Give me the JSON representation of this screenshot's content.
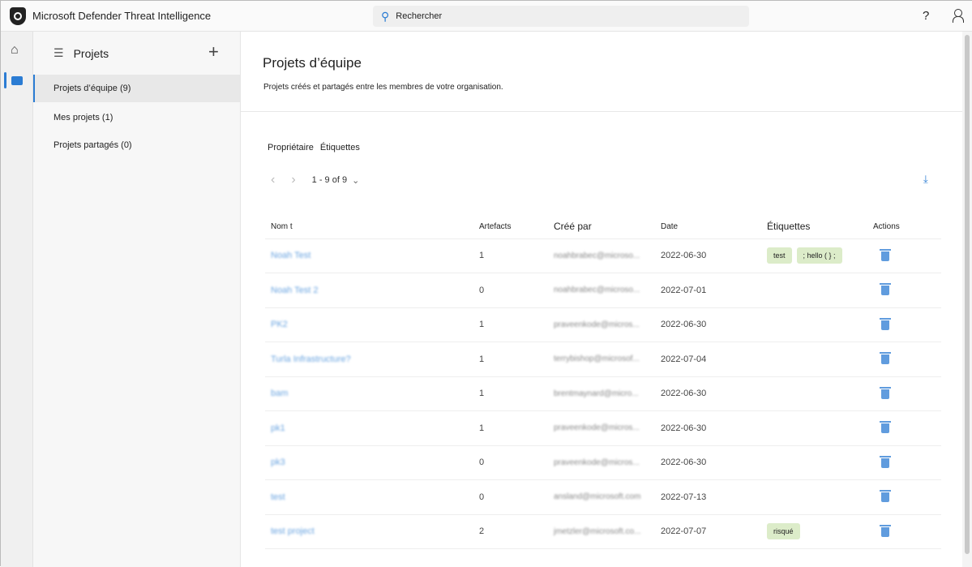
{
  "app": {
    "title": "Microsoft Defender Threat Intelligence",
    "search_placeholder": "Rechercher",
    "help": "?"
  },
  "sidebar": {
    "title": "Projets",
    "items": [
      {
        "label": "Projets d’équipe (9)"
      },
      {
        "label": "Mes projets (1)"
      },
      {
        "label": "Projets partagés (0)"
      }
    ]
  },
  "main": {
    "title": "Projets d’équipe",
    "subtitle": "Projets créés et partagés entre les membres de votre organisation.",
    "filters": [
      "Propriétaire",
      "Étiquettes"
    ],
    "pager": "1 - 9 of 9",
    "columns": [
      "Nom t",
      "Artefacts",
      "Créé par",
      "Date",
      "Étiquettes",
      "Actions"
    ],
    "rows": [
      {
        "name": "Noah Test",
        "artifacts": "1",
        "creator": "noahbrabec@microso...",
        "date": "2022-06-30",
        "tags": [
          "test",
          "; hello ( } ;"
        ]
      },
      {
        "name": "Noah Test 2",
        "artifacts": "0",
        "creator": "noahbrabec@microso...",
        "date": "2022-07-01",
        "tags": []
      },
      {
        "name": "PK2",
        "artifacts": "1",
        "creator": "praveenkode@micros...",
        "date": "2022-06-30",
        "tags": []
      },
      {
        "name": "Turla Infrastructure?",
        "artifacts": "1",
        "creator": "terrybishop@microsof...",
        "date": "2022-07-04",
        "tags": []
      },
      {
        "name": "bam",
        "artifacts": "1",
        "creator": "brentmaynard@micro...",
        "date": "2022-06-30",
        "tags": []
      },
      {
        "name": "pk1",
        "artifacts": "1",
        "creator": "praveenkode@micros...",
        "date": "2022-06-30",
        "tags": []
      },
      {
        "name": "pk3",
        "artifacts": "0",
        "creator": "praveenkode@micros...",
        "date": "2022-06-30",
        "tags": []
      },
      {
        "name": "test",
        "artifacts": "0",
        "creator": "ansland@microsoft.com",
        "date": "2022-07-13",
        "tags": []
      },
      {
        "name": "test project",
        "artifacts": "2",
        "creator": "jmetzler@microsoft.co...",
        "date": "2022-07-07",
        "tags": [
          "risqué"
        ]
      }
    ]
  },
  "colors": {
    "accent": "#2b7cd3",
    "tag_bg": "#dcecc9"
  }
}
